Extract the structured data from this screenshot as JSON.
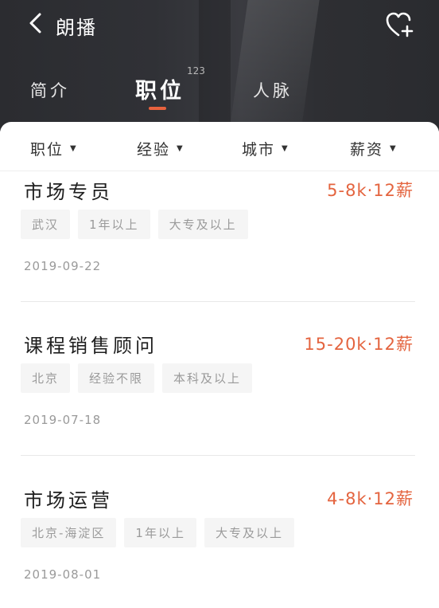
{
  "header": {
    "title": "朗播",
    "back_icon": "chevron-left-icon",
    "favorite_icon": "heart-plus-icon"
  },
  "tabs": [
    {
      "label": "简介",
      "active": false
    },
    {
      "label": "职位",
      "active": true,
      "count": "123"
    },
    {
      "label": "人脉",
      "active": false
    }
  ],
  "filters": [
    {
      "label": "职位"
    },
    {
      "label": "经验"
    },
    {
      "label": "城市"
    },
    {
      "label": "薪资"
    }
  ],
  "jobs": [
    {
      "title": "市场专员",
      "salary": "5-8k·12薪",
      "tags": [
        "武汉",
        "1年以上",
        "大专及以上"
      ],
      "date": "2019-09-22"
    },
    {
      "title": "课程销售顾问",
      "salary": "15-20k·12薪",
      "tags": [
        "北京",
        "经验不限",
        "本科及以上"
      ],
      "date": "2019-07-18"
    },
    {
      "title": "市场运营",
      "salary": "4-8k·12薪",
      "tags": [
        "北京-海淀区",
        "1年以上",
        "大专及以上"
      ],
      "date": "2019-08-01"
    }
  ],
  "colors": {
    "accent": "#e4643f",
    "header_bg": "#2e2f33",
    "tag_bg": "#f5f5f5"
  }
}
